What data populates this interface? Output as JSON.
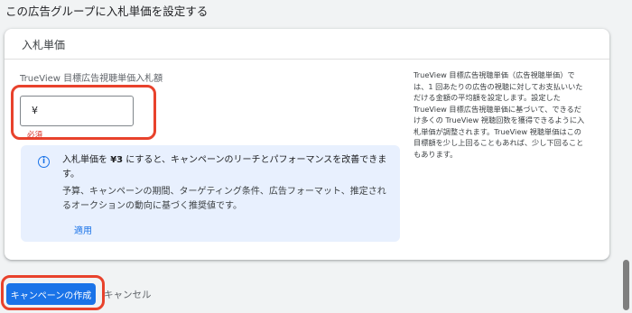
{
  "section": {
    "title": "この広告グループに入札単価を設定する"
  },
  "card": {
    "header_title": "入札単価",
    "field_label": "TrueView 目標広告視聴単価入札額",
    "currency_symbol": "¥",
    "bid_value": "",
    "required_text": "必須",
    "info": {
      "icon": "info-icon",
      "main_prefix": "入札単価を ",
      "main_bold": "¥3",
      "main_suffix": " にすると、キャンペーンのリーチとパフォーマンスを改善できます。",
      "sub": "予算、キャンペーンの期間、ターゲティング条件、広告フォーマット、推定されるオークションの動向に基づく推奨値です。",
      "apply_label": "適用"
    },
    "help_text": "TrueView 目標広告視聴単価（広告視聴単価）では、1 回あたりの広告の視聴に対してお支払いいただける金額の平均額を設定します。設定した TrueView 目標広告視聴単価に基づいて、できるだけ多くの TrueView 視聴回数を獲得できるように入札単価が調整されます。TrueView 視聴単価はこの目標額を少し上回ることもあれば、少し下回ることもあります。"
  },
  "actions": {
    "create_label": "キャンペーンの作成",
    "cancel_label": "キャンセル"
  },
  "colors": {
    "primary": "#1a73e8",
    "highlight": "#e8422c",
    "required": "#d93025",
    "info_bg": "#e8f0fe"
  }
}
